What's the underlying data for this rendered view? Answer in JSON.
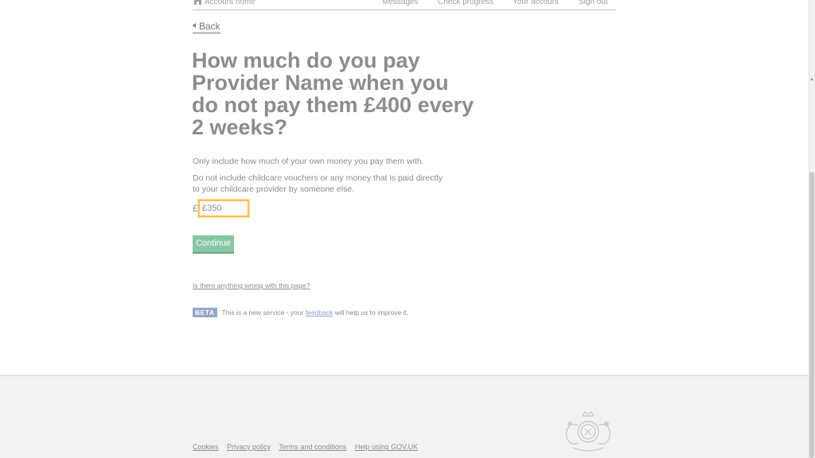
{
  "nav": {
    "account_home": "Account home",
    "messages": "Messages",
    "check_progress": "Check progress",
    "your_account": "Your account",
    "sign_out": "Sign out",
    "home_icon": "home-icon"
  },
  "back_link": "Back",
  "question": {
    "heading": "How much do you pay Provider Name when you do not pay them £400 every 2 weeks?",
    "hint1": "Only include how much of your own money you pay them with.",
    "hint2": "Do not include childcare vouchers or any money that is paid directly to your childcare provider by someone else."
  },
  "amount": {
    "prefix": "£",
    "value": "£350"
  },
  "continue_label": "Continue",
  "wrong_page_link": "Is there anything wrong with this page?",
  "beta": {
    "tag": "BETA",
    "text_before": "This is a new service  - your ",
    "feedback": "feedback",
    "text_after": " will help us to improve it."
  },
  "footer": {
    "links": [
      "Cookies",
      "Privacy policy",
      "Terms and conditions",
      "Help using GOV.UK"
    ],
    "crest_icon": "royal-crest-icon"
  },
  "colors": {
    "continue_bg": "#85c8a1",
    "focus_border": "#ffbf47",
    "beta_tag_bg": "#94a6c4",
    "footer_bg": "#f2f2f2"
  }
}
